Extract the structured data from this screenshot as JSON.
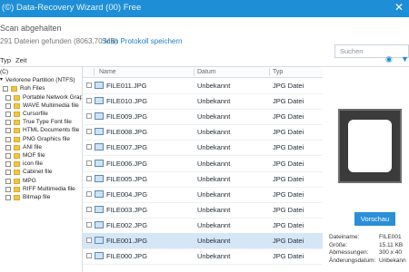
{
  "window": {
    "title": "(©) Data-Recovery Wizard (00) Free",
    "close_glyph": "✕"
  },
  "scan": {
    "heading": "Scan abgehalten",
    "summary": "291 Dateien gefunden (8063,70 MB)",
    "save_link": "Scan Protokoll speichern"
  },
  "search": {
    "placeholder": "Suchen"
  },
  "toolbar": {
    "type_tab": "Typ",
    "time_tab": "Zeit"
  },
  "tree": {
    "items": [
      {
        "label": "(C)",
        "level": 0
      },
      {
        "label": "Verlorene Partition (NTFS)",
        "level": 0
      },
      {
        "label": "Roh Files",
        "level": 1
      },
      {
        "label": "Portable Network Graph",
        "level": 2
      },
      {
        "label": "WAVE Multimedia file",
        "level": 2
      },
      {
        "label": "Cursorfile",
        "level": 2
      },
      {
        "label": "True Type Font file",
        "level": 2
      },
      {
        "label": "HTML Documents file",
        "level": 2
      },
      {
        "label": "PNG Graphics file",
        "level": 2
      },
      {
        "label": "ANI file",
        "level": 2
      },
      {
        "label": "MOF file",
        "level": 2
      },
      {
        "label": "icon file",
        "level": 2
      },
      {
        "label": "Cabinet file",
        "level": 2
      },
      {
        "label": "MPG",
        "level": 2
      },
      {
        "label": "RIFF Multimedia file",
        "level": 2
      },
      {
        "label": "Bitmap file",
        "level": 2
      }
    ]
  },
  "columns": {
    "name": "Name",
    "date": "Datum",
    "type": "Typ"
  },
  "files": [
    {
      "name": "FILE011.JPG",
      "date": "Unbekannt",
      "type": "JPG Datei"
    },
    {
      "name": "FILE010.JPG",
      "date": "Unbekannt",
      "type": "JPG Datei"
    },
    {
      "name": "FILE009.JPG",
      "date": "Unbekannt",
      "type": "JPG Datei"
    },
    {
      "name": "FILE008.JPG",
      "date": "Unbekannt",
      "type": "JPG Datei"
    },
    {
      "name": "FILE007.JPG",
      "date": "Unbekannt",
      "type": "JPG Datei"
    },
    {
      "name": "FILE006.JPG",
      "date": "Unbekannt",
      "type": "JPG Datei"
    },
    {
      "name": "FILE005.JPG",
      "date": "Unbekannt",
      "type": "JPG Datei"
    },
    {
      "name": "FILE004.JPG",
      "date": "Unbekannt",
      "type": "JPG Datei"
    },
    {
      "name": "FILE003.JPG",
      "date": "Unbekannt",
      "type": "JPG Datei"
    },
    {
      "name": "FILE002.JPG",
      "date": "Unbekannt",
      "type": "JPG Datei"
    },
    {
      "name": "FILE001.JPG",
      "date": "Unbekannt",
      "type": "JPG Datei",
      "selected": true
    },
    {
      "name": "FILE000.JPG",
      "date": "Unbekannt",
      "type": "JPG Datei"
    }
  ],
  "preview": {
    "button": "Vorschau",
    "meta": [
      {
        "label": "Dateiname:",
        "value": "FILE001"
      },
      {
        "label": "Größe:",
        "value": "15.11 KB"
      },
      {
        "label": "Abmessungen:",
        "value": "300 x 40"
      },
      {
        "label": "Änderungsdatum:",
        "value": "Unbekann"
      }
    ]
  },
  "colors": {
    "accent": "#1e8fd6",
    "selected_row": "#d5e6f7",
    "folder": "#f0c64a"
  }
}
